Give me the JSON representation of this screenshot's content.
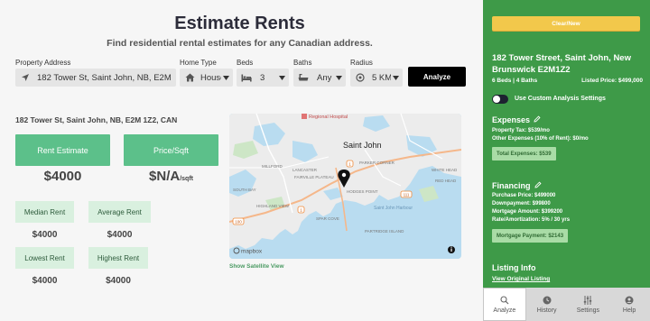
{
  "header": {
    "title": "Estimate Rents",
    "subtitle": "Find residential rental estimates for any Canadian address."
  },
  "form": {
    "address": {
      "label": "Property Address",
      "value": "182 Tower St, Saint John, NB, E2M",
      "icon": "navigation-arrow-icon"
    },
    "home_type": {
      "label": "Home Type",
      "value": "House",
      "icon": "house-icon"
    },
    "beds": {
      "label": "Beds",
      "value": "3",
      "icon": "bed-icon"
    },
    "baths": {
      "label": "Baths",
      "value": "Any",
      "icon": "bathtub-icon"
    },
    "radius": {
      "label": "Radius",
      "value": "5 KM",
      "icon": "target-icon"
    },
    "analyze_label": "Analyze"
  },
  "results": {
    "address_line": "182 Tower St, Saint John, NB, E2M 1Z2, CAN",
    "rent_estimate": {
      "label": "Rent Estimate",
      "value": "$4000"
    },
    "price_sqft": {
      "label": "Price/Sqft",
      "value": "$N/A",
      "unit": "/sqft"
    },
    "median": {
      "label": "Median Rent",
      "value": "$4000"
    },
    "average": {
      "label": "Average Rent",
      "value": "$4000"
    },
    "lowest": {
      "label": "Lowest Rent",
      "value": "$4000"
    },
    "highest": {
      "label": "Highest Rent",
      "value": "$4000"
    }
  },
  "map": {
    "labels": {
      "regional_hospital": "Regional Hospital",
      "saint_john": "Saint John",
      "parker_corner": "PARKER CORNER",
      "south_bay": "SOUTH BAY",
      "fairville_plateau": "FAIRVILLE PLATEAU",
      "lancaster": "LANCASTER",
      "millford": "MILLFORD",
      "highland_view": "HIGHLAND VIEW",
      "saint_john_harbour": "Saint John Harbour",
      "white_head": "WHITE HEAD",
      "red_head": "RED HEAD",
      "spar_cove": "SPAR COVE",
      "hodges_point": "HODGES POINT",
      "partridge_island": "PARTRIDGE ISLAND",
      "mapbox": "mapbox"
    },
    "road_numbers": [
      "100",
      "1",
      "1",
      "111"
    ],
    "satellite_link": "Show Satellite View"
  },
  "sidebar": {
    "clear_label": "Clear/New",
    "property_title": "182 Tower Street, Saint John, New Brunswick E2M1Z2",
    "beds_baths": "6 Beds  |  4 Baths",
    "listed_price": "Listed Price: $499,000",
    "custom_toggle_label": "Use Custom Analysis Settings",
    "expenses": {
      "title": "Expenses",
      "property_tax": "Property Tax: $539/mo",
      "other": "Other Expenses (10% of Rent): $0/mo",
      "total": "Total Expenses: $539"
    },
    "financing": {
      "title": "Financing",
      "purchase_price": "Purchase Price: $499000",
      "downpayment": "Downpayment: $99800",
      "mortgage_amount": "Mortgage Amount: $399200",
      "rate": "Rate/Amortization: 5% / 30 yrs",
      "payment": "Mortgage Payment: $2143"
    },
    "listing": {
      "title": "Listing Info",
      "link": "View Original Listing"
    },
    "tabs": [
      {
        "label": "Analyze",
        "icon": "search-icon"
      },
      {
        "label": "History",
        "icon": "history-icon"
      },
      {
        "label": "Settings",
        "icon": "sliders-icon"
      },
      {
        "label": "Help",
        "icon": "user-icon"
      }
    ]
  },
  "colors": {
    "accent_green": "#5cc08a",
    "sidebar_green": "#3e9a48",
    "clear_yellow": "#f2c84b",
    "stat_box": "#d9f0df"
  }
}
